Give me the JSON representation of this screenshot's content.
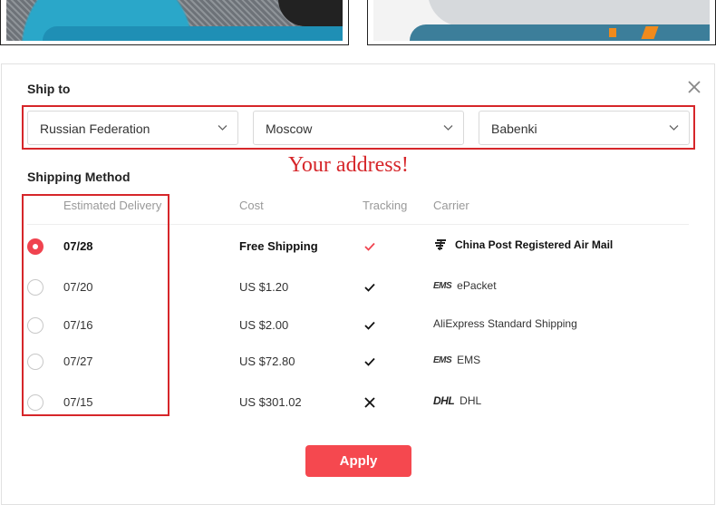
{
  "modal": {
    "ship_to_title": "Ship to",
    "shipping_method_title": "Shipping Method",
    "close_icon": "close-icon",
    "selects": {
      "country": "Russian Federation",
      "city": "Moscow",
      "district": "Babenki"
    },
    "annotation_text": "Your address!",
    "annotation_color": "#d6262a",
    "columns": {
      "delivery": "Estimated Delivery",
      "cost": "Cost",
      "tracking": "Tracking",
      "carrier": "Carrier"
    },
    "rows": [
      {
        "date": "07/28",
        "cost": "Free Shipping",
        "tracking": "check-icon",
        "carrier_logo": "china-post-logo",
        "carrier": "China Post Registered Air Mail",
        "selected": true
      },
      {
        "date": "07/20",
        "cost": "US $1.20",
        "tracking": "check-icon",
        "carrier_logo": "ems-logo",
        "carrier_logo_text": "EMS",
        "carrier": "ePacket",
        "selected": false
      },
      {
        "date": "07/16",
        "cost": "US $2.00",
        "tracking": "check-icon",
        "carrier_logo": "",
        "carrier": "AliExpress Standard Shipping",
        "selected": false
      },
      {
        "date": "07/27",
        "cost": "US $72.80",
        "tracking": "check-icon",
        "carrier_logo": "ems-logo",
        "carrier_logo_text": "EMS",
        "carrier": "EMS",
        "selected": false
      },
      {
        "date": "07/15",
        "cost": "US $301.02",
        "tracking": "cross-icon",
        "carrier_logo": "dhl-logo",
        "carrier_logo_text": "DHL",
        "carrier": "DHL",
        "selected": false
      }
    ],
    "apply_label": "Apply",
    "accent_color": "#f5484f"
  }
}
